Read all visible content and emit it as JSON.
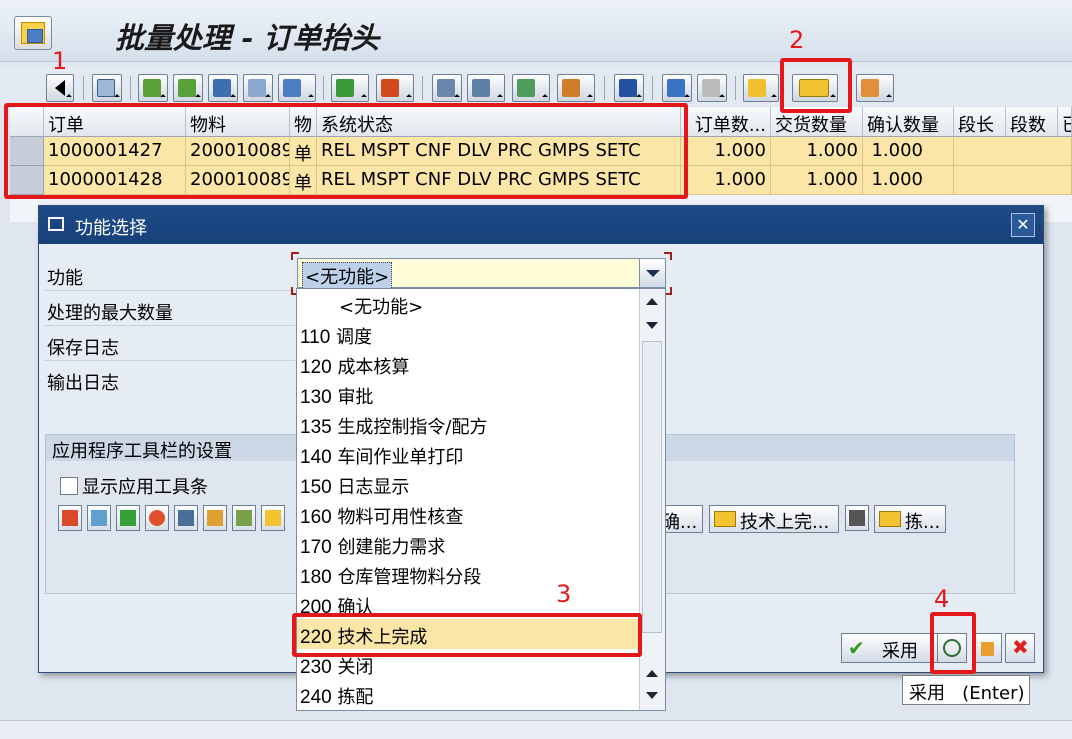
{
  "window": {
    "title": "批量处理 - 订单抬头"
  },
  "toolbar": {
    "buttons": [
      "back",
      "find",
      "sort-asc",
      "sort-desc",
      "binoculars",
      "binoculars-next",
      "filter",
      "sum",
      "subtotal",
      "print",
      "view",
      "export",
      "layout",
      "info",
      "edit",
      "glasses",
      "undo",
      "mass-process",
      "settings"
    ]
  },
  "grid": {
    "headers": {
      "order": "订单",
      "material": "物料",
      "mat_short": "物",
      "status": "系统状态",
      "order_qty": "订单数...",
      "delivered": "交货数量",
      "confirmed": "确认数量",
      "seg_len": "段长",
      "seg_count": "段数",
      "more": "已"
    },
    "rows": [
      {
        "order": "1000001427",
        "material": "200010089",
        "mat_short": "单",
        "status": "REL  MSPT CNF  DLV  PRC  GMPS SETC",
        "order_qty": "1.000",
        "delivered": "1.000",
        "confirmed": "1.000"
      },
      {
        "order": "1000001428",
        "material": "200010089",
        "mat_short": "单",
        "status": "REL  MSPT CNF  DLV  PRC  GMPS SETC",
        "order_qty": "1.000",
        "delivered": "1.000",
        "confirmed": "1.000"
      }
    ]
  },
  "dialog": {
    "title": "功能选择",
    "fields": {
      "function": "功能",
      "max_count": "处理的最大数量",
      "save_log": "保存日志",
      "output_log": "输出日志"
    },
    "combo_value": "<无功能>",
    "group_title": "应用程序工具栏的设置",
    "show_toolbar_label": "显示应用工具条",
    "toolbar_buttons": {
      "confirm": "确...",
      "teco": "技术上完...",
      "pick": "拣..."
    },
    "ok_label": "采用",
    "tooltip": {
      "label": "采用",
      "key": "(Enter)"
    }
  },
  "dropdown": {
    "items": [
      {
        "code": "",
        "label": "<无功能>"
      },
      {
        "code": "110",
        "label": "调度"
      },
      {
        "code": "120",
        "label": "成本核算"
      },
      {
        "code": "130",
        "label": "审批"
      },
      {
        "code": "135",
        "label": "生成控制指令/配方"
      },
      {
        "code": "140",
        "label": "车间作业单打印"
      },
      {
        "code": "150",
        "label": "日志显示"
      },
      {
        "code": "160",
        "label": "物料可用性核查"
      },
      {
        "code": "170",
        "label": "创建能力需求"
      },
      {
        "code": "180",
        "label": "仓库管理物料分段"
      },
      {
        "code": "200",
        "label": "确认"
      },
      {
        "code": "220",
        "label": "技术上完成"
      },
      {
        "code": "230",
        "label": "关闭"
      },
      {
        "code": "240",
        "label": "拣配"
      }
    ],
    "selected_index": 11
  },
  "annotations": [
    "1",
    "2",
    "3",
    "4"
  ],
  "colors": {
    "selected_row": "#fbe6a7",
    "annotation": "#e4181a",
    "dialog_header": "#1e4c87"
  }
}
